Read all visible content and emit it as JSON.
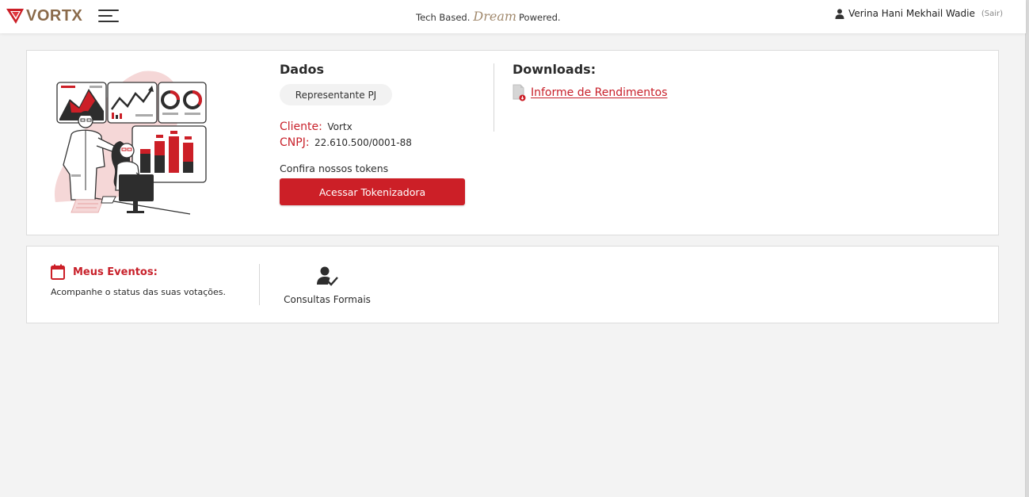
{
  "header": {
    "brand": "VORTX",
    "tagline_before": "Tech Based.",
    "tagline_dream": "Dream",
    "tagline_after": "Powered.",
    "user_name": "Verina Hani Mekhail Wadie",
    "logout_label": "(Sair)"
  },
  "dados": {
    "title": "Dados",
    "profile_type": "Representante PJ",
    "cliente_label": "Cliente:",
    "cliente_value": "Vortx",
    "cnpj_label": "CNPJ:",
    "cnpj_value": "22.610.500/0001-88",
    "tokens_label": "Confira nossos tokens",
    "tokens_button": "Acessar Tokenizadora"
  },
  "downloads": {
    "title": "Downloads:",
    "items": [
      {
        "label": "Informe de Rendimentos"
      }
    ]
  },
  "eventos": {
    "title": "Meus Eventos:",
    "description": "Acompanhe o status das suas votações.",
    "consultas_label": "Consultas Formais"
  },
  "colors": {
    "brand_red": "#cc1f27",
    "brand_gold": "#8a6a4a",
    "background": "#f3f3f3",
    "card": "#ffffff"
  }
}
